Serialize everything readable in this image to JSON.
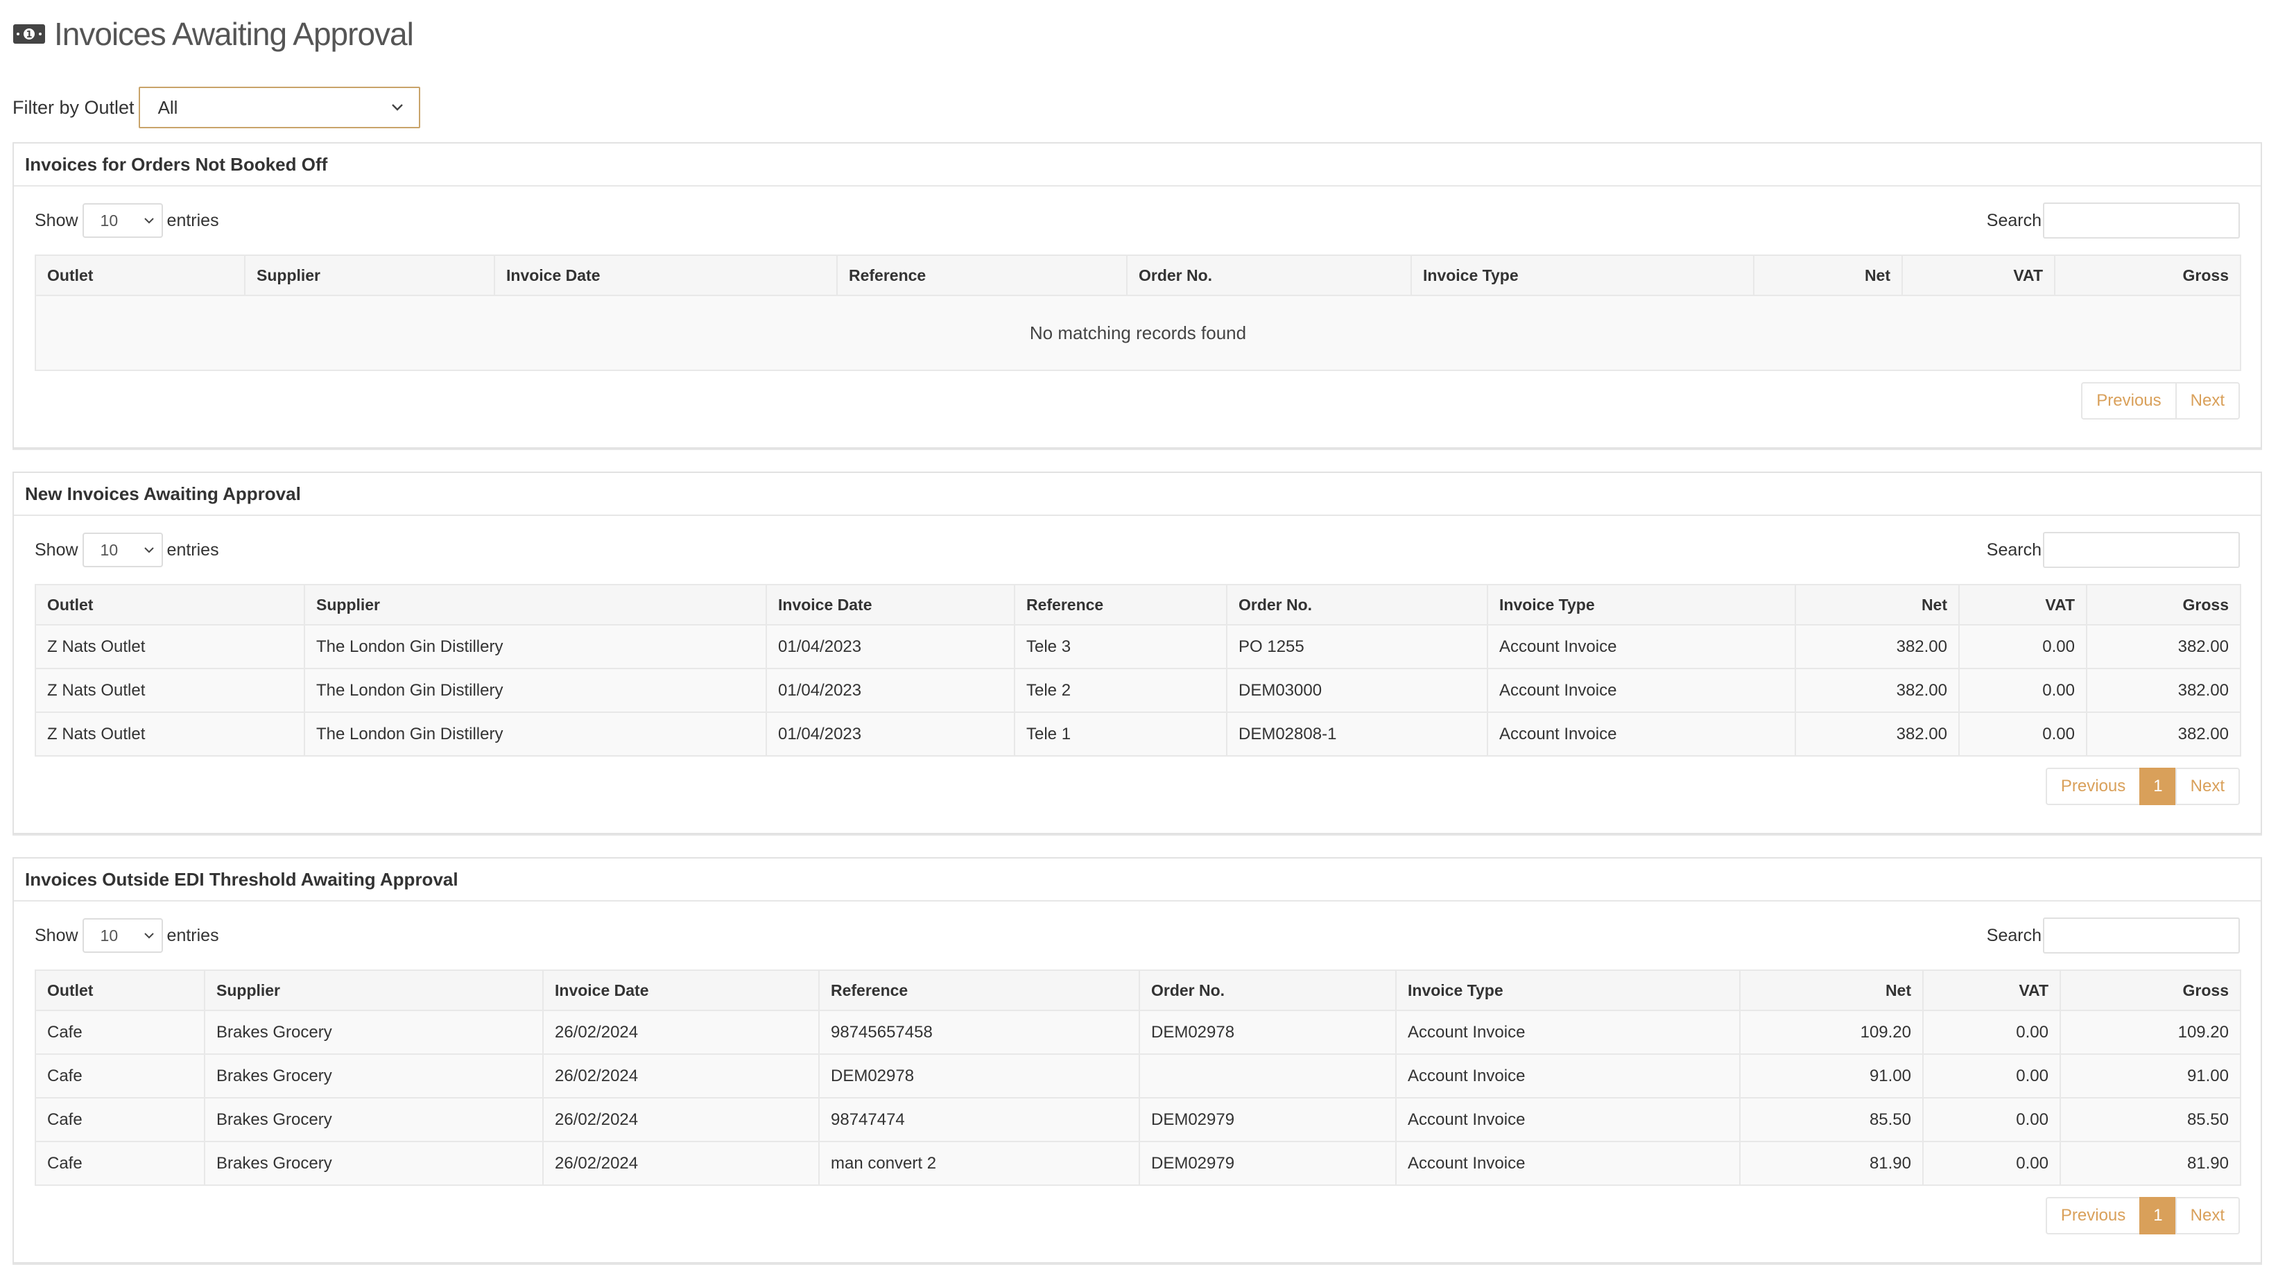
{
  "page": {
    "title": "Invoices Awaiting Approval",
    "title_icon": "money-bill-icon",
    "accent_color": "#d9a05a"
  },
  "filter": {
    "label": "Filter by Outlet",
    "selected": "All"
  },
  "common": {
    "show_label": "Show",
    "entries_label": "entries",
    "page_length": "10",
    "search_label": "Search",
    "previous_label": "Previous",
    "next_label": "Next"
  },
  "panels": [
    {
      "title": "Invoices for Orders Not Booked Off",
      "columns": [
        "Outlet",
        "Supplier",
        "Invoice Date",
        "Reference",
        "Order No.",
        "Invoice Type",
        "Net",
        "VAT",
        "Gross"
      ],
      "rows": [],
      "empty_message": "No matching records found",
      "pages": []
    },
    {
      "title": "New Invoices Awaiting Approval",
      "columns": [
        "Outlet",
        "Supplier",
        "Invoice Date",
        "Reference",
        "Order No.",
        "Invoice Type",
        "Net",
        "VAT",
        "Gross"
      ],
      "rows": [
        [
          "Z Nats Outlet",
          "The London Gin Distillery",
          "01/04/2023",
          "Tele 3",
          "PO 1255",
          "Account Invoice",
          "382.00",
          "0.00",
          "382.00"
        ],
        [
          "Z Nats Outlet",
          "The London Gin Distillery",
          "01/04/2023",
          "Tele 2",
          "DEM03000",
          "Account Invoice",
          "382.00",
          "0.00",
          "382.00"
        ],
        [
          "Z Nats Outlet",
          "The London Gin Distillery",
          "01/04/2023",
          "Tele 1",
          "DEM02808-1",
          "Account Invoice",
          "382.00",
          "0.00",
          "382.00"
        ]
      ],
      "pages": [
        "1"
      ]
    },
    {
      "title": "Invoices Outside EDI Threshold Awaiting Approval",
      "columns": [
        "Outlet",
        "Supplier",
        "Invoice Date",
        "Reference",
        "Order No.",
        "Invoice Type",
        "Net",
        "VAT",
        "Gross"
      ],
      "rows": [
        [
          "Cafe",
          "Brakes Grocery",
          "26/02/2024",
          "98745657458",
          "DEM02978",
          "Account Invoice",
          "109.20",
          "0.00",
          "109.20"
        ],
        [
          "Cafe",
          "Brakes Grocery",
          "26/02/2024",
          "DEM02978",
          "",
          "Account Invoice",
          "91.00",
          "0.00",
          "91.00"
        ],
        [
          "Cafe",
          "Brakes Grocery",
          "26/02/2024",
          "98747474",
          "DEM02979",
          "Account Invoice",
          "85.50",
          "0.00",
          "85.50"
        ],
        [
          "Cafe",
          "Brakes Grocery",
          "26/02/2024",
          "man convert 2",
          "DEM02979",
          "Account Invoice",
          "81.90",
          "0.00",
          "81.90"
        ]
      ],
      "pages": [
        "1"
      ]
    }
  ]
}
